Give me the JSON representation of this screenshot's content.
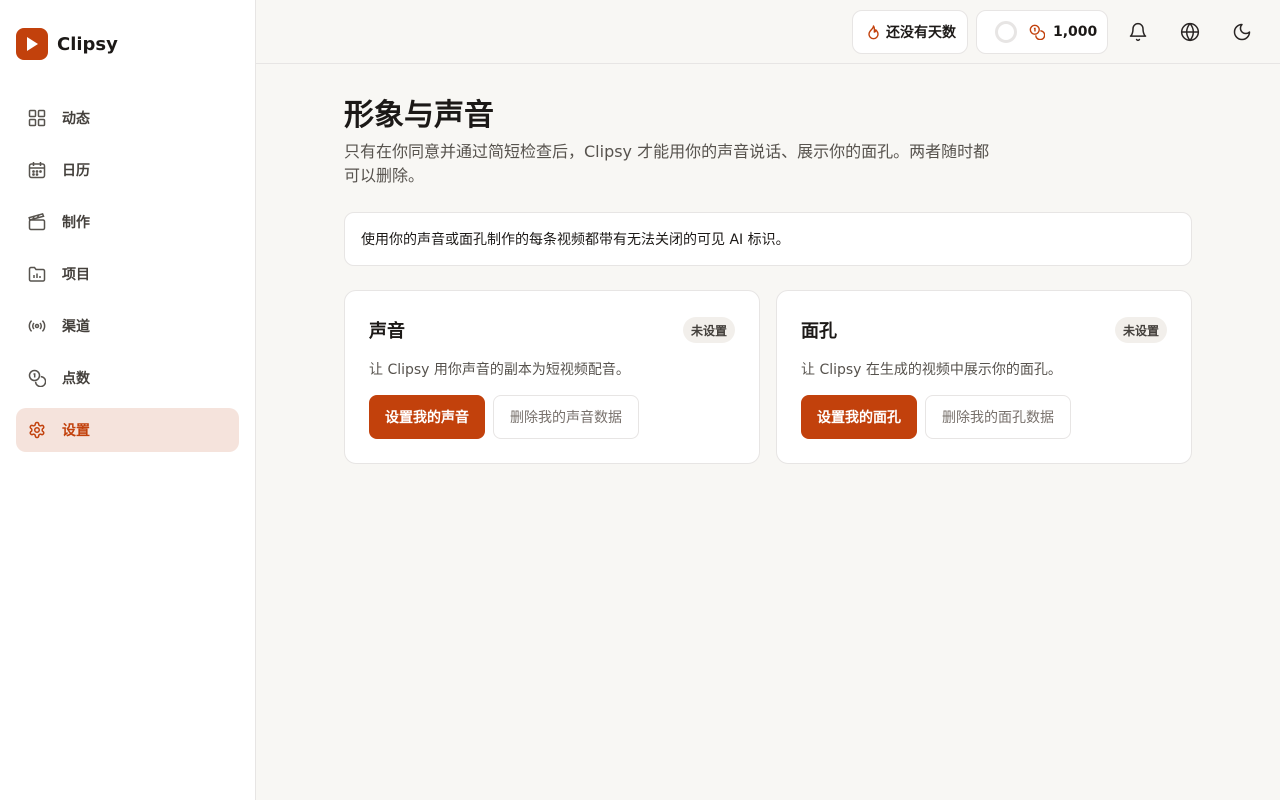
{
  "app": {
    "name": "Clipsy"
  },
  "sidebar": {
    "items": [
      {
        "label": "动态",
        "icon": "grid-icon"
      },
      {
        "label": "日历",
        "icon": "calendar-icon"
      },
      {
        "label": "制作",
        "icon": "clapperboard-icon"
      },
      {
        "label": "项目",
        "icon": "folder-chart-icon"
      },
      {
        "label": "渠道",
        "icon": "broadcast-icon"
      },
      {
        "label": "点数",
        "icon": "coins-icon"
      },
      {
        "label": "设置",
        "icon": "gear-icon",
        "active": true
      }
    ]
  },
  "topbar": {
    "streak_label": "还没有天数",
    "credits_value": "1,000"
  },
  "page": {
    "title": "形象与声音",
    "description": "只有在你同意并通过简短检查后，Clipsy 才能用你的声音说话、展示你的面孔。两者随时都可以删除。",
    "notice": "使用你的声音或面孔制作的每条视频都带有无法关闭的可见 AI 标识。"
  },
  "voice_card": {
    "title": "声音",
    "status": "未设置",
    "description": "让 Clipsy 用你声音的副本为短视频配音。",
    "primary_button": "设置我的声音",
    "secondary_button": "删除我的声音数据"
  },
  "face_card": {
    "title": "面孔",
    "status": "未设置",
    "description": "让 Clipsy 在生成的视频中展示你的面孔。",
    "primary_button": "设置我的面孔",
    "secondary_button": "删除我的面孔数据"
  },
  "colors": {
    "accent": "#c2410c",
    "active_bg": "#f5e3dc",
    "background": "#f8f7f4"
  }
}
